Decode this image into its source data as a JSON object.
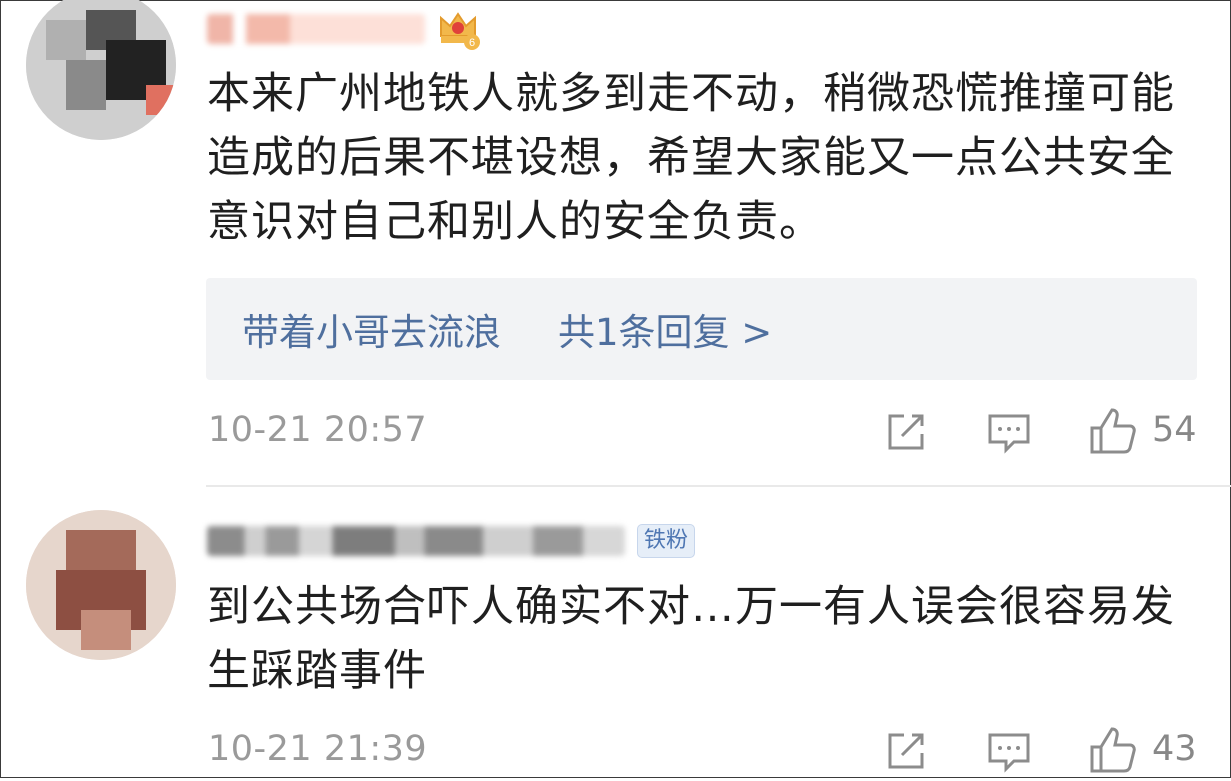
{
  "comments": [
    {
      "text": "本来广州地铁人就多到走不动，稍微恐慌推撞可能造成的后果不堪设想，希望大家能又一点公共安全意识对自己和别人的安全负责。",
      "lines": [
        "本来广州地铁人就多到走不动，稍微恐慌推撞可能",
        "造成的后果不堪设想，希望大家能又一点公共安全",
        "意识对自己和别人的安全负责。"
      ],
      "reply_user": "带着小哥去流浪",
      "reply_count": "共1条回复 >",
      "time": "10-21 20:57",
      "likes": "54",
      "badge_icon": "crown-level-badge-icon",
      "badge_level": "6"
    },
    {
      "lines": [
        "到公共场合吓人确实不对…万一有人误会很容易发",
        "生踩踏事件"
      ],
      "time": "10-21 21:39",
      "likes": "43",
      "badge": "铁粉"
    }
  ],
  "icons": {
    "share": "share-icon",
    "comment": "comment-icon",
    "like": "thumbs-up-icon"
  },
  "colors": {
    "link": "#4f6f9e",
    "muted": "#9a9a9a",
    "reply_bg": "#f2f3f5"
  }
}
